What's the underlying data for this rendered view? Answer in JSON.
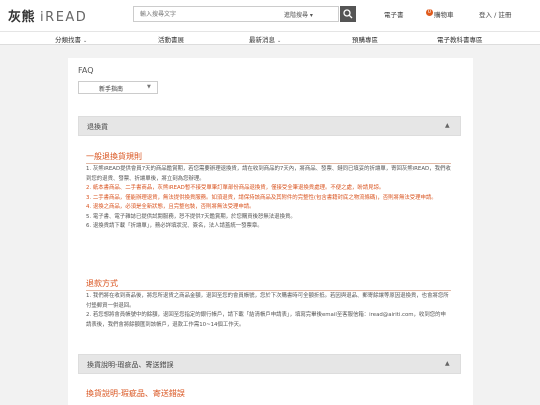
{
  "header": {
    "logo_cn": "灰熊",
    "logo_en": "iREAD",
    "search_placeholder": "輸入搜尋文字",
    "search_mode": "進階搜尋 ▾",
    "ebook": "電子書",
    "cart_count": "0",
    "cart": "購物車",
    "login": "登入 / 註冊"
  },
  "menu": {
    "items": [
      "分類找書",
      "活動書展",
      "最新消息",
      "預購專區",
      "電子教科書專區"
    ]
  },
  "faq": {
    "title": "FAQ",
    "select_value": "新手指南",
    "section1": "退換貨",
    "sub1_title": "一般退換貨規則",
    "rules": [
      "1. 灰熊iREAD提供會員7天的商品鑑賞期，若您需要辦理退換貨，請在收到商品的7天內，將商品、發票、鏈同已填妥的折讓單，寄回灰熊iREAD，我們收到您的退貨、發票、折讓單後，將立刻為您辦理。",
      "2. 紙本書商品、二手書商品，灰熊iREAD暫不接受單筆訂單部份商品退換貨，僅接受全筆退換貨處理。不便之處，盼請見諒。",
      "3. 二手書商品，僅能辦理退貨，無法提供換貨服務。如須退貨，請保持該商品及其附件的完整性(包含書籍封底之物流條碼)，否則將無法受理申請。",
      "4. 退換之商品，必須是全新狀態，且完整包裝，否則將無法受理申請。",
      "5. 電子書、電子雜誌已提供試閱服務，恕不提供7天鑑賞期，於您購買後恕無法退換貨。",
      "6. 退換貨請下載「折讓單」，務必詳填狀況、簽名，法人請蓋統一發票章。"
    ],
    "sub2_title": "退款方式",
    "refund": [
      "1. 我們將在收到商品後，將您所退貨之商品金額，退回至您的會員帳號，您於下次購書時可全額折抵。若因與退品、郵寄餘讓等原因退換貨，也會將您所付墊郵資一併退回。",
      "2. 若您想將會員帳號中的餘額，退回至您指定的銀行帳戶，請下載「結清帳戶申請表」，填寫完畢後email至客服信箱：iread@airiti.com，收到您的申請表後，我們會將餘額匯到該帳戶，退款工作需10~14個工作天。"
    ],
    "section2": "換貨說明-瑕疵品、寄送錯誤",
    "sub3_title": "換貨說明-瑕疵品、寄送錯誤"
  }
}
